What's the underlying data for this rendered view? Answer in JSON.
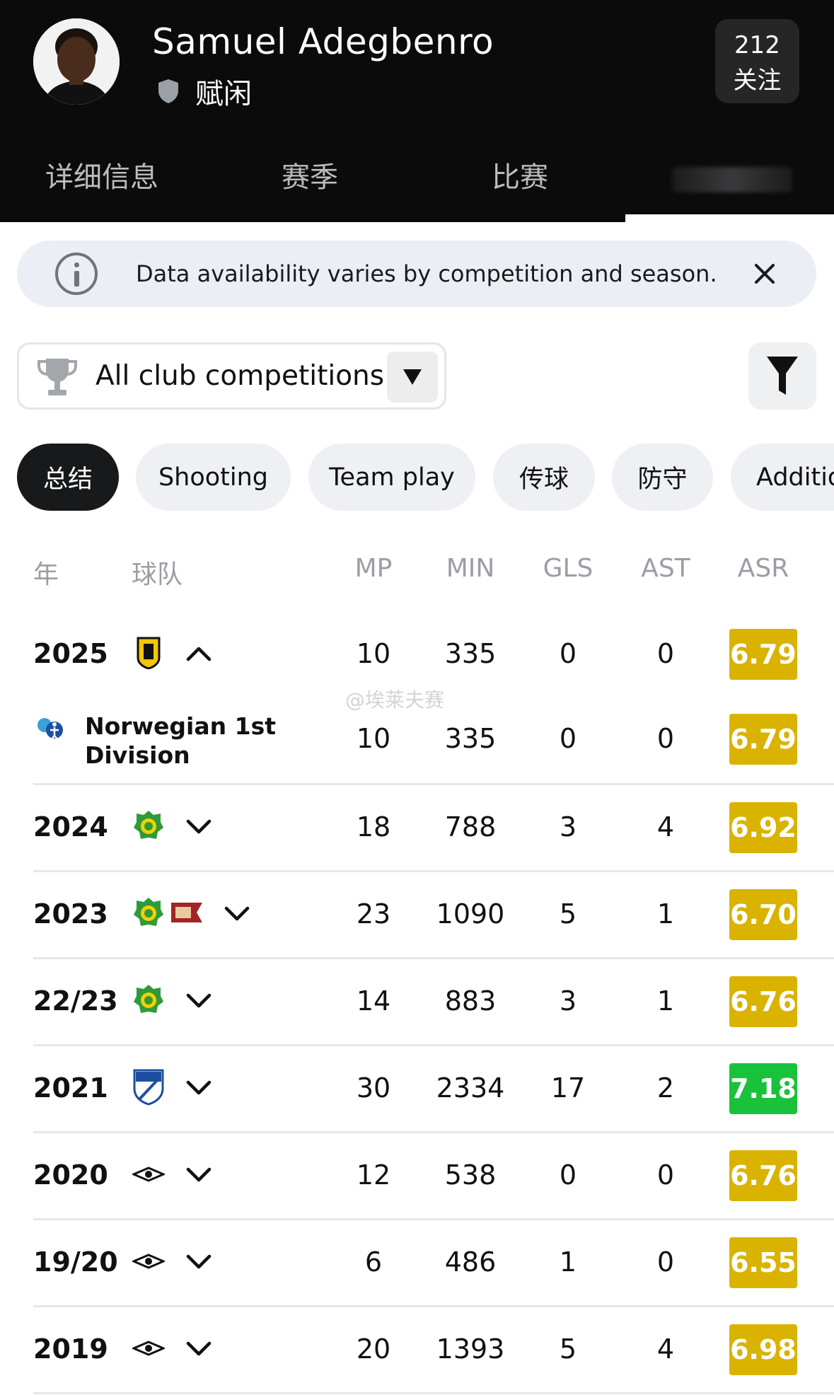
{
  "player": {
    "name": "Samuel Adegbenro",
    "status": "赋闲",
    "followers_count": "212",
    "followers_label": "关注"
  },
  "tabs": [
    {
      "label": "详细信息"
    },
    {
      "label": "赛季"
    },
    {
      "label": "比赛"
    }
  ],
  "banner": {
    "text": "Data availability varies by competition and season."
  },
  "competition_filter": {
    "selected": "All club competitions"
  },
  "categories": [
    {
      "label": "总结",
      "active": true
    },
    {
      "label": "Shooting"
    },
    {
      "label": "Team play"
    },
    {
      "label": "传球"
    },
    {
      "label": "防守"
    },
    {
      "label": "Additio"
    }
  ],
  "table": {
    "headers": {
      "year": "年",
      "team": "球队",
      "mp": "MP",
      "min": "MIN",
      "gls": "GLS",
      "ast": "AST",
      "asr": "ASR"
    },
    "rows": [
      {
        "year": "2025",
        "mp": "10",
        "min": "335",
        "gls": "0",
        "ast": "0",
        "asr": "6.79",
        "expanded": true
      },
      {
        "league": "Norwegian 1st Division",
        "mp": "10",
        "min": "335",
        "gls": "0",
        "ast": "0",
        "asr": "6.79"
      },
      {
        "year": "2024",
        "mp": "18",
        "min": "788",
        "gls": "3",
        "ast": "4",
        "asr": "6.92"
      },
      {
        "year": "2023",
        "mp": "23",
        "min": "1090",
        "gls": "5",
        "ast": "1",
        "asr": "6.70"
      },
      {
        "year": "22/23",
        "mp": "14",
        "min": "883",
        "gls": "3",
        "ast": "1",
        "asr": "6.76"
      },
      {
        "year": "2021",
        "mp": "30",
        "min": "2334",
        "gls": "17",
        "ast": "2",
        "asr": "7.18"
      },
      {
        "year": "2020",
        "mp": "12",
        "min": "538",
        "gls": "0",
        "ast": "0",
        "asr": "6.76"
      },
      {
        "year": "19/20",
        "mp": "6",
        "min": "486",
        "gls": "1",
        "ast": "0",
        "asr": "6.55"
      },
      {
        "year": "2019",
        "mp": "20",
        "min": "1393",
        "gls": "5",
        "ast": "4",
        "asr": "6.98"
      }
    ]
  },
  "colors": {
    "rating_gold": "#d9b300",
    "rating_green": "#19c23a",
    "header_bg": "#0b0b0c"
  },
  "watermark": "@埃莱夫赛"
}
